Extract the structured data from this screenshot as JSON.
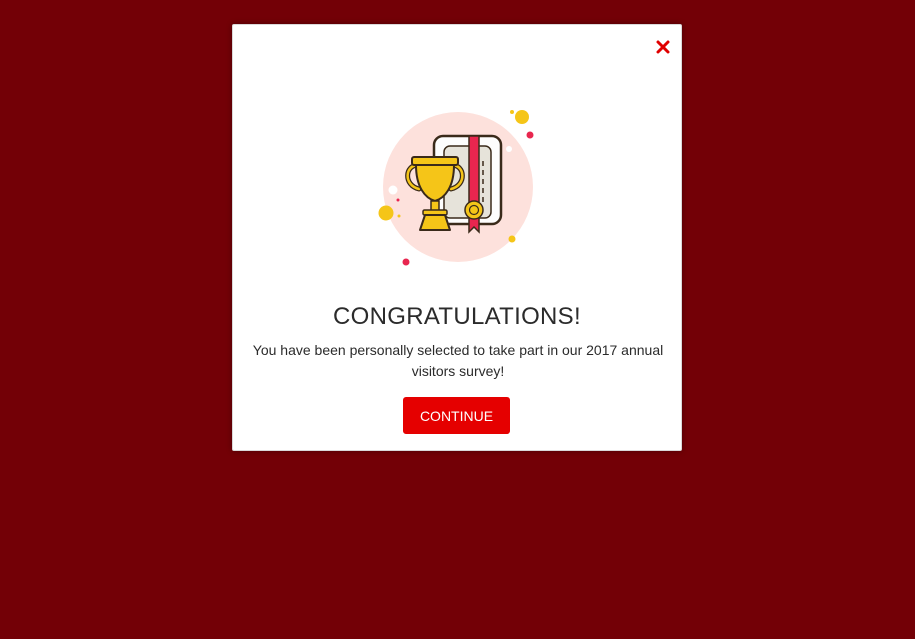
{
  "modal": {
    "title": "CONGRATULATIONS!",
    "message": "You have been personally selected to take part in our 2017 annual visitors survey!",
    "continue_label": "CONTINUE",
    "close_icon": "close-icon"
  },
  "colors": {
    "background": "#730006",
    "accent": "#e50000",
    "close": "#e00000",
    "trophy": "#f5c518",
    "ribbon": "#e8264f",
    "circle": "#fde1dc"
  }
}
